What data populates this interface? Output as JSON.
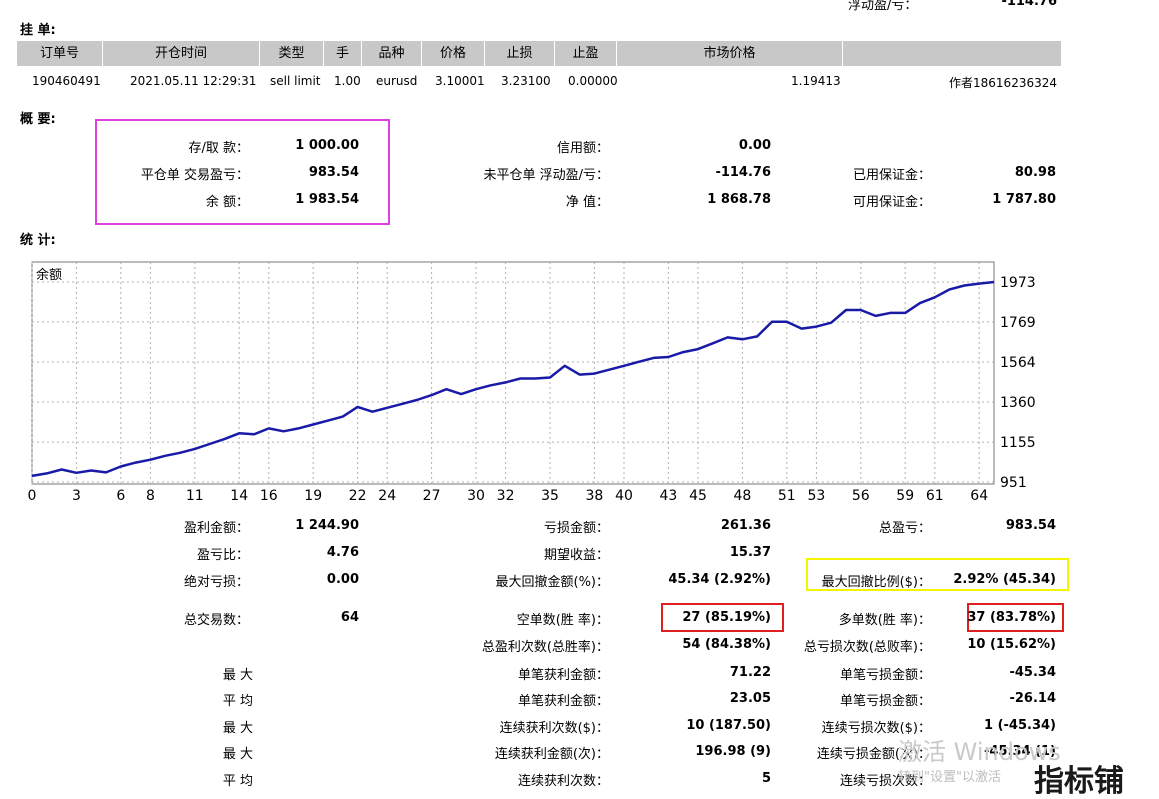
{
  "top_partial": {
    "label": "浮动盈/亏：",
    "value": "-114.76"
  },
  "pending": {
    "title": "挂 单:",
    "headers": [
      "订单号",
      "开仓时间",
      "类型",
      "手",
      "品种",
      "价格",
      "止损",
      "止盈",
      "市场价格",
      ""
    ],
    "row": [
      "190460491",
      "2021.05.11 12:29:31",
      "sell limit",
      "1.00",
      "eurusd",
      "3.10001",
      "3.23100",
      "0.00000",
      "1.19413",
      "作者18616236324"
    ]
  },
  "summary": {
    "title": "概 要:",
    "deposit_label": "存/取 款：",
    "deposit": "1 000.00",
    "closed_pl_label": "平仓单 交易盈亏：",
    "closed_pl": "983.54",
    "balance_label": "余 额：",
    "balance": "1 983.54",
    "credit_label": "信用额：",
    "credit": "0.00",
    "floating_label": "未平仓单 浮动盈/亏：",
    "floating": "-114.76",
    "equity_label": "净 值：",
    "equity": "1 868.78",
    "margin_label": "已用保证金：",
    "margin": "80.98",
    "free_margin_label": "可用保证金：",
    "free_margin": "1 787.80"
  },
  "stats": {
    "title": "统 计:",
    "gross_profit_label": "盈利金额：",
    "gross_profit": "1 244.90",
    "gross_loss_label": "亏损金额：",
    "gross_loss": "261.36",
    "total_net_label": "总盈亏：",
    "total_net": "983.54",
    "profit_factor_label": "盈亏比：",
    "profit_factor": "4.76",
    "expected_payoff_label": "期望收益：",
    "expected_payoff": "15.37",
    "abs_drawdown_label": "绝对亏损：",
    "abs_drawdown": "0.00",
    "max_dd_label": "最大回撤金额(%)：",
    "max_dd": "45.34 (2.92%)",
    "rel_dd_label": "最大回撤比例($)：",
    "rel_dd": "2.92% (45.34)",
    "total_trades_label": "总交易数：",
    "total_trades": "64",
    "short_label": "空单数(胜 率)：",
    "short": "27 (85.19%)",
    "long_label": "多单数(胜 率)：",
    "long": "37 (83.78%)",
    "profit_trades_label": "总盈利次数(总胜率)：",
    "profit_trades": "54 (84.38%)",
    "loss_trades_label": "总亏损次数(总败率)：",
    "loss_trades": "10 (15.62%)",
    "max1": "最 大",
    "largest_profit_label": "单笔获利金额：",
    "largest_profit": "71.22",
    "largest_loss_label": "单笔亏损金额：",
    "largest_loss": "-45.34",
    "avg1": "平 均",
    "avg_profit_label": "单笔获利金额：",
    "avg_profit": "23.05",
    "avg_loss_label": "单笔亏损金额：",
    "avg_loss": "-26.14",
    "max2": "最 大",
    "max_consec_wins_label": "连续获利次数($)：",
    "max_consec_wins": "10 (187.50)",
    "max_consec_losses_label": "连续亏损次数($)：",
    "max_consec_losses": "1 (-45.34)",
    "max3": "最 大",
    "max_consec_profit_label": "连续获利金额(次)：",
    "max_consec_profit": "196.98 (9)",
    "max_consec_loss_label": "连续亏损金额(次)：",
    "max_consec_loss": "-45.34 (1)",
    "avg2": "平 均",
    "avg_consec_wins_label": "连续获利次数：",
    "avg_consec_wins": "5",
    "avg_consec_losses_label": "连续亏损次数：",
    "avg_consec_losses": ""
  },
  "watermark": {
    "line1": "激活 Windows",
    "line2": "转到\"设置\"以激活",
    "logo": "指标铺"
  },
  "colors": {
    "line": "#1a1aa8",
    "magenta": "#e040e0",
    "red": "#e02020",
    "yellow": "#f5f500",
    "header_bg": "#c8c8c8"
  },
  "chart_data": {
    "type": "line",
    "title": "余额",
    "x_ticks": [
      0,
      3,
      6,
      8,
      11,
      14,
      16,
      19,
      22,
      24,
      27,
      30,
      32,
      35,
      38,
      40,
      43,
      45,
      48,
      51,
      53,
      56,
      59,
      61,
      64
    ],
    "y_ticks": [
      951,
      1155,
      1360,
      1564,
      1769,
      1973
    ],
    "xlim": [
      0,
      65
    ],
    "ylim": [
      951,
      1973
    ],
    "grid": true,
    "series": [
      {
        "x": [
          0,
          1,
          2,
          3,
          4,
          5,
          6,
          7,
          8,
          9,
          10,
          11,
          12,
          13,
          14,
          15,
          16,
          17,
          18,
          19,
          20,
          21,
          22,
          23,
          24,
          25,
          26,
          27,
          28,
          29,
          30,
          31,
          32,
          33,
          34,
          35,
          36,
          37,
          38,
          39,
          40,
          41,
          42,
          43,
          44,
          45,
          46,
          47,
          48,
          49,
          50,
          51,
          52,
          53,
          54,
          55,
          56,
          57,
          58,
          59,
          60,
          61,
          62,
          63,
          64,
          65
        ],
        "y": [
          982,
          995,
          1015,
          998,
          1010,
          1000,
          1030,
          1050,
          1065,
          1085,
          1100,
          1120,
          1145,
          1170,
          1200,
          1195,
          1225,
          1210,
          1225,
          1245,
          1265,
          1285,
          1335,
          1310,
          1330,
          1350,
          1370,
          1395,
          1425,
          1400,
          1425,
          1445,
          1460,
          1480,
          1480,
          1485,
          1545,
          1500,
          1505,
          1525,
          1545,
          1565,
          1585,
          1590,
          1615,
          1630,
          1660,
          1690,
          1680,
          1695,
          1770,
          1770,
          1735,
          1745,
          1765,
          1830,
          1830,
          1800,
          1815,
          1815,
          1865,
          1895,
          1935,
          1955,
          1965,
          1973
        ]
      }
    ]
  }
}
